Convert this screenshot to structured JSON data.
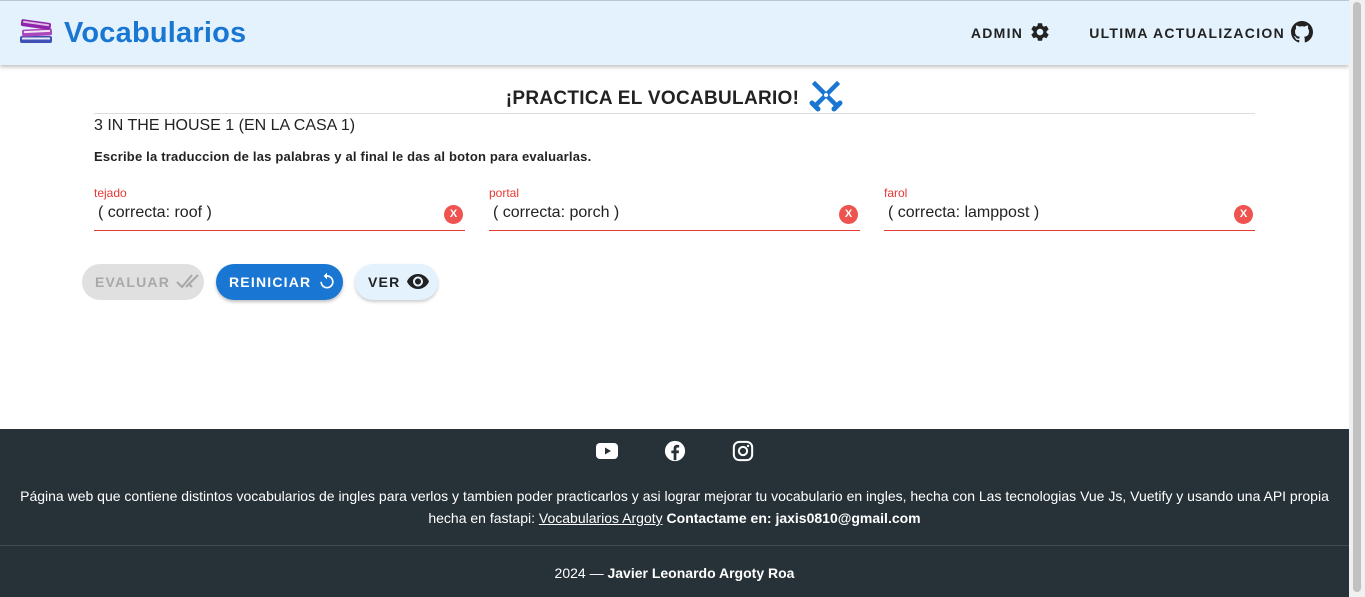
{
  "header": {
    "brand_title": "Vocabularios",
    "logo_icon": "books-icon",
    "nav": {
      "admin_label": "ADMIN",
      "admin_icon": "gear-icon",
      "update_label": "ULTIMA ACTUALIZACION",
      "update_icon": "github-icon"
    },
    "accent_color": "#1976d2",
    "background_color": "#e3f2fd"
  },
  "practice": {
    "title": "¡PRACTICA EL VOCABULARIO!",
    "title_icon": "crossed-swords-icon",
    "lesson_title": "3 IN THE HOUSE 1 (EN LA CASA 1)",
    "instructions": "Escribe la traduccion de las palabras y al final le das al boton para evaluarlas.",
    "fields": [
      {
        "label": "tejado",
        "value": "( correcta: roof )",
        "clear_label": "X"
      },
      {
        "label": "portal",
        "value": "( correcta: porch )",
        "clear_label": "X"
      },
      {
        "label": "farol",
        "value": "( correcta: lamppost )",
        "clear_label": "X"
      }
    ],
    "error_color": "#e53935"
  },
  "actions": {
    "evaluar_label": "EVALUAR",
    "evaluar_icon": "double-check-icon",
    "reiniciar_label": "REINICIAR",
    "reiniciar_icon": "restart-icon",
    "ver_label": "VER",
    "ver_icon": "eye-icon"
  },
  "footer": {
    "social_icons": [
      "youtube-icon",
      "facebook-icon",
      "instagram-icon"
    ],
    "description": "Página web que contiene distintos vocabularios de ingles para verlos y tambien poder practicarlos y asi lograr mejorar tu vocabulario en ingles, hecha con Las tecnologias Vue Js, Vuetify y usando una API propia hecha en fastapi:",
    "link_text": "Vocabularios Argoty",
    "contact_text": "Contactame en: jaxis0810@gmail.com",
    "year": "2024 —",
    "author": "Javier Leonardo Argoty Roa",
    "background_color": "#263238"
  }
}
